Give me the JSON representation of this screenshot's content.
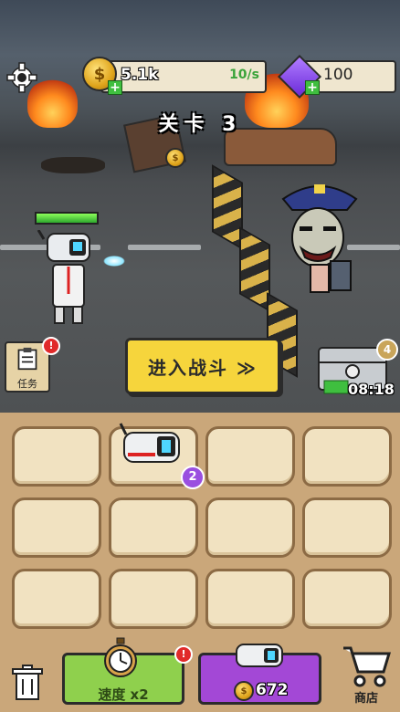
{
  "hud": {
    "coins": "5.1k",
    "coin_rate": "10/s",
    "gems": "100"
  },
  "stage": {
    "title": "关卡 3"
  },
  "actions": {
    "enter_battle": "进入战斗 ≫",
    "task_label": "任务",
    "chest_timer": "08:18",
    "chest_count": "4",
    "speed_label": "速度 x2",
    "buy_price": "672",
    "shop_label": "商店"
  },
  "board": {
    "slots": [
      {
        "item": "",
        "level": ""
      },
      {
        "item": "robot-unit",
        "level": "2"
      },
      {
        "item": "",
        "level": ""
      },
      {
        "item": "",
        "level": ""
      },
      {
        "item": "",
        "level": ""
      },
      {
        "item": "",
        "level": ""
      },
      {
        "item": "",
        "level": ""
      },
      {
        "item": "",
        "level": ""
      },
      {
        "item": "",
        "level": ""
      },
      {
        "item": "",
        "level": ""
      },
      {
        "item": "",
        "level": ""
      },
      {
        "item": "",
        "level": ""
      }
    ]
  },
  "player": {
    "hp_fraction": 1.0
  },
  "icons": {
    "settings": "gear-icon",
    "coin": "coin-icon",
    "gem": "gem-icon",
    "trash": "trash-icon",
    "cart": "cart-icon",
    "stopwatch": "stopwatch-icon"
  },
  "colors": {
    "battle_button": "#f6d53c",
    "speed_button": "#8fd04d",
    "buy_button": "#a348d6",
    "alert": "#e12a2a"
  }
}
